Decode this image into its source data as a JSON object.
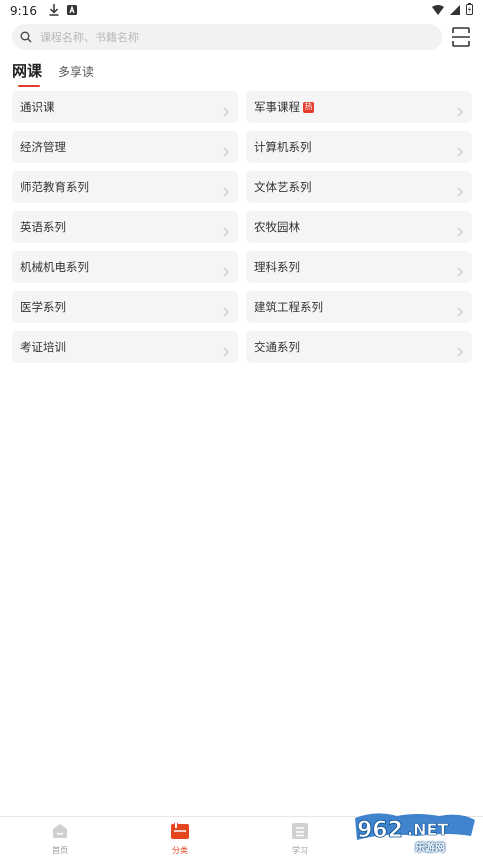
{
  "status_bar": {
    "time": "9:16"
  },
  "search": {
    "placeholder": "课程名称、书籍名称"
  },
  "tabs": [
    {
      "label": "网课",
      "active": true
    },
    {
      "label": "多享读",
      "active": false
    }
  ],
  "categories": [
    {
      "label": "通识课",
      "hot": false
    },
    {
      "label": "军事课程",
      "hot": true,
      "hot_badge": "热"
    },
    {
      "label": "经济管理",
      "hot": false
    },
    {
      "label": "计算机系列",
      "hot": false
    },
    {
      "label": "师范教育系列",
      "hot": false
    },
    {
      "label": "文体艺系列",
      "hot": false
    },
    {
      "label": "英语系列",
      "hot": false
    },
    {
      "label": "农牧园林",
      "hot": false
    },
    {
      "label": "机械机电系列",
      "hot": false
    },
    {
      "label": "理科系列",
      "hot": false
    },
    {
      "label": "医学系列",
      "hot": false
    },
    {
      "label": "建筑工程系列",
      "hot": false
    },
    {
      "label": "考证培训",
      "hot": false
    },
    {
      "label": "交通系列",
      "hot": false
    }
  ],
  "bottom_nav": [
    {
      "label": "首页",
      "icon": "home-icon",
      "active": false
    },
    {
      "label": "分类",
      "icon": "category-icon",
      "active": true
    },
    {
      "label": "学习",
      "icon": "study-icon",
      "active": false
    }
  ],
  "watermark": {
    "logo_text": "962.NET",
    "text": "乐游网"
  },
  "colors": {
    "accent": "#e63b2e",
    "cell_bg": "#f5f5f5",
    "search_bg": "#f2f2f2"
  }
}
